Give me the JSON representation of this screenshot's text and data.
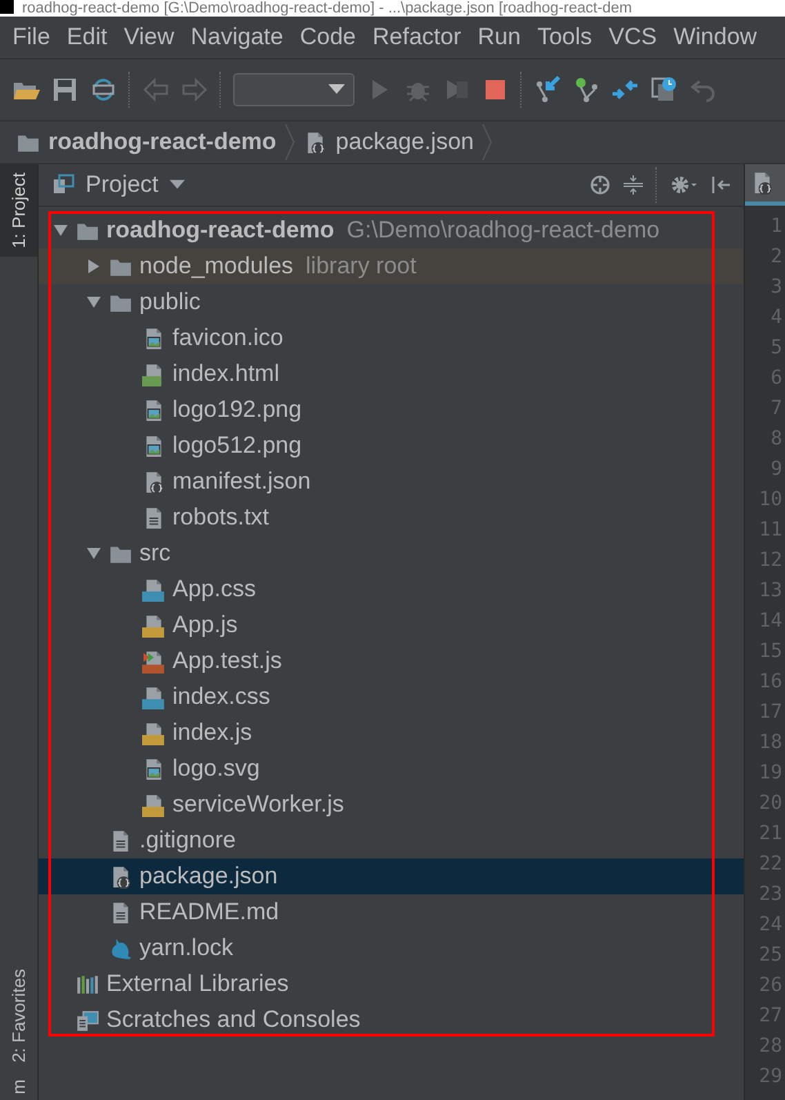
{
  "window": {
    "title": "roadhog-react-demo [G:\\Demo\\roadhog-react-demo] - ...\\package.json [roadhog-react-dem"
  },
  "menu": [
    "File",
    "Edit",
    "View",
    "Navigate",
    "Code",
    "Refactor",
    "Run",
    "Tools",
    "VCS",
    "Window"
  ],
  "breadcrumb": [
    {
      "kind": "project",
      "label": "roadhog-react-demo"
    },
    {
      "kind": "json",
      "label": "package.json"
    }
  ],
  "side_tabs": [
    {
      "label": "1: Project",
      "selected": true
    },
    {
      "label": "2: Favorites",
      "selected": false
    },
    {
      "label": "m",
      "selected": false
    }
  ],
  "panel": {
    "title": "Project"
  },
  "tree": [
    {
      "kind": "project",
      "name": "roadhog-react-demo",
      "hint": "G:\\Demo\\roadhog-react-demo",
      "expanded": true,
      "selected": false,
      "children": [
        {
          "kind": "library",
          "name": "node_modules",
          "hint": "library root",
          "expanded": false,
          "selected": false
        },
        {
          "kind": "folder",
          "name": "public",
          "expanded": true,
          "selected": false,
          "children": [
            {
              "kind": "image",
              "name": "favicon.ico",
              "selected": false
            },
            {
              "kind": "html",
              "name": "index.html",
              "selected": false
            },
            {
              "kind": "image",
              "name": "logo192.png",
              "selected": false
            },
            {
              "kind": "image",
              "name": "logo512.png",
              "selected": false
            },
            {
              "kind": "json",
              "name": "manifest.json",
              "selected": false
            },
            {
              "kind": "text",
              "name": "robots.txt",
              "selected": false
            }
          ]
        },
        {
          "kind": "folder",
          "name": "src",
          "expanded": true,
          "selected": false,
          "children": [
            {
              "kind": "css",
              "name": "App.css",
              "selected": false
            },
            {
              "kind": "js",
              "name": "App.js",
              "selected": false
            },
            {
              "kind": "jstest",
              "name": "App.test.js",
              "selected": false
            },
            {
              "kind": "css",
              "name": "index.css",
              "selected": false
            },
            {
              "kind": "js",
              "name": "index.js",
              "selected": false
            },
            {
              "kind": "image",
              "name": "logo.svg",
              "selected": false
            },
            {
              "kind": "js",
              "name": "serviceWorker.js",
              "selected": false
            }
          ]
        },
        {
          "kind": "text",
          "name": ".gitignore",
          "selected": false
        },
        {
          "kind": "json",
          "name": "package.json",
          "selected": true
        },
        {
          "kind": "text",
          "name": "README.md",
          "selected": false
        },
        {
          "kind": "yarn",
          "name": "yarn.lock",
          "selected": false
        }
      ]
    },
    {
      "kind": "libraries",
      "name": "External Libraries",
      "selected": false
    },
    {
      "kind": "scratches",
      "name": "Scratches and Consoles",
      "selected": false
    }
  ],
  "line_numbers": [
    "1",
    "2",
    "3",
    "4",
    "5",
    "6",
    "7",
    "8",
    "9",
    "10",
    "11",
    "12",
    "13",
    "14",
    "15",
    "16",
    "17",
    "18",
    "19",
    "20",
    "21",
    "22",
    "23",
    "24",
    "25",
    "26",
    "27",
    "28",
    "29"
  ]
}
